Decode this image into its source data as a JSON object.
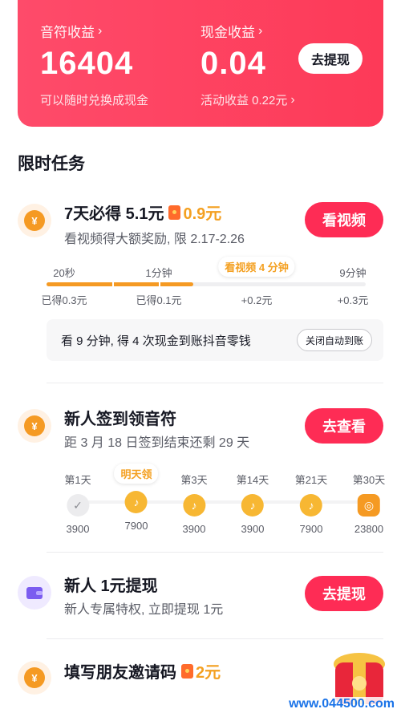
{
  "earnings": {
    "notes_label": "音符收益",
    "notes_value": "16404",
    "notes_sub": "可以随时兑换成现金",
    "cash_label": "现金收益",
    "cash_value": "0.04",
    "cash_sub": "活动收益 0.22元",
    "withdraw_label": "去提现"
  },
  "section_title": "限时任务",
  "task1": {
    "title": "7天必得 5.1元",
    "reward": "0.9元",
    "desc": "看视频得大额奖励, 限 2.17-2.26",
    "button": "看视频",
    "progress": {
      "ticks": [
        "20秒",
        "1分钟",
        "看视频 4 分钟",
        "9分钟"
      ],
      "bottoms": [
        "已得0.3元",
        "已得0.1元",
        "+0.2元",
        "+0.3元"
      ],
      "filled_fraction": 0.46
    },
    "info_text": "看 9 分钟, 得 4 次现金到账抖音零钱",
    "info_button": "关闭自动到账"
  },
  "task2": {
    "title": "新人签到领音符",
    "desc": "距 3 月 18 日签到结束还剩 29 天",
    "button": "去查看",
    "days": [
      {
        "label": "第1天",
        "amount": "3900",
        "state": "done"
      },
      {
        "label": "明天领",
        "amount": "7900",
        "state": "tomorrow"
      },
      {
        "label": "第3天",
        "amount": "3900",
        "state": "future"
      },
      {
        "label": "第14天",
        "amount": "3900",
        "state": "future"
      },
      {
        "label": "第21天",
        "amount": "7900",
        "state": "future"
      },
      {
        "label": "第30天",
        "amount": "23800",
        "state": "big"
      }
    ]
  },
  "task3": {
    "title": "新人 1元提现",
    "desc": "新人专属特权, 立即提现 1元",
    "button": "去提现"
  },
  "task4": {
    "title": "填写朋友邀请码",
    "reward": "2元"
  },
  "watermark": "www.044500.com",
  "colors": {
    "brand_red": "#fe2c55",
    "gold": "#f4a021",
    "coin": "#f59a23"
  }
}
